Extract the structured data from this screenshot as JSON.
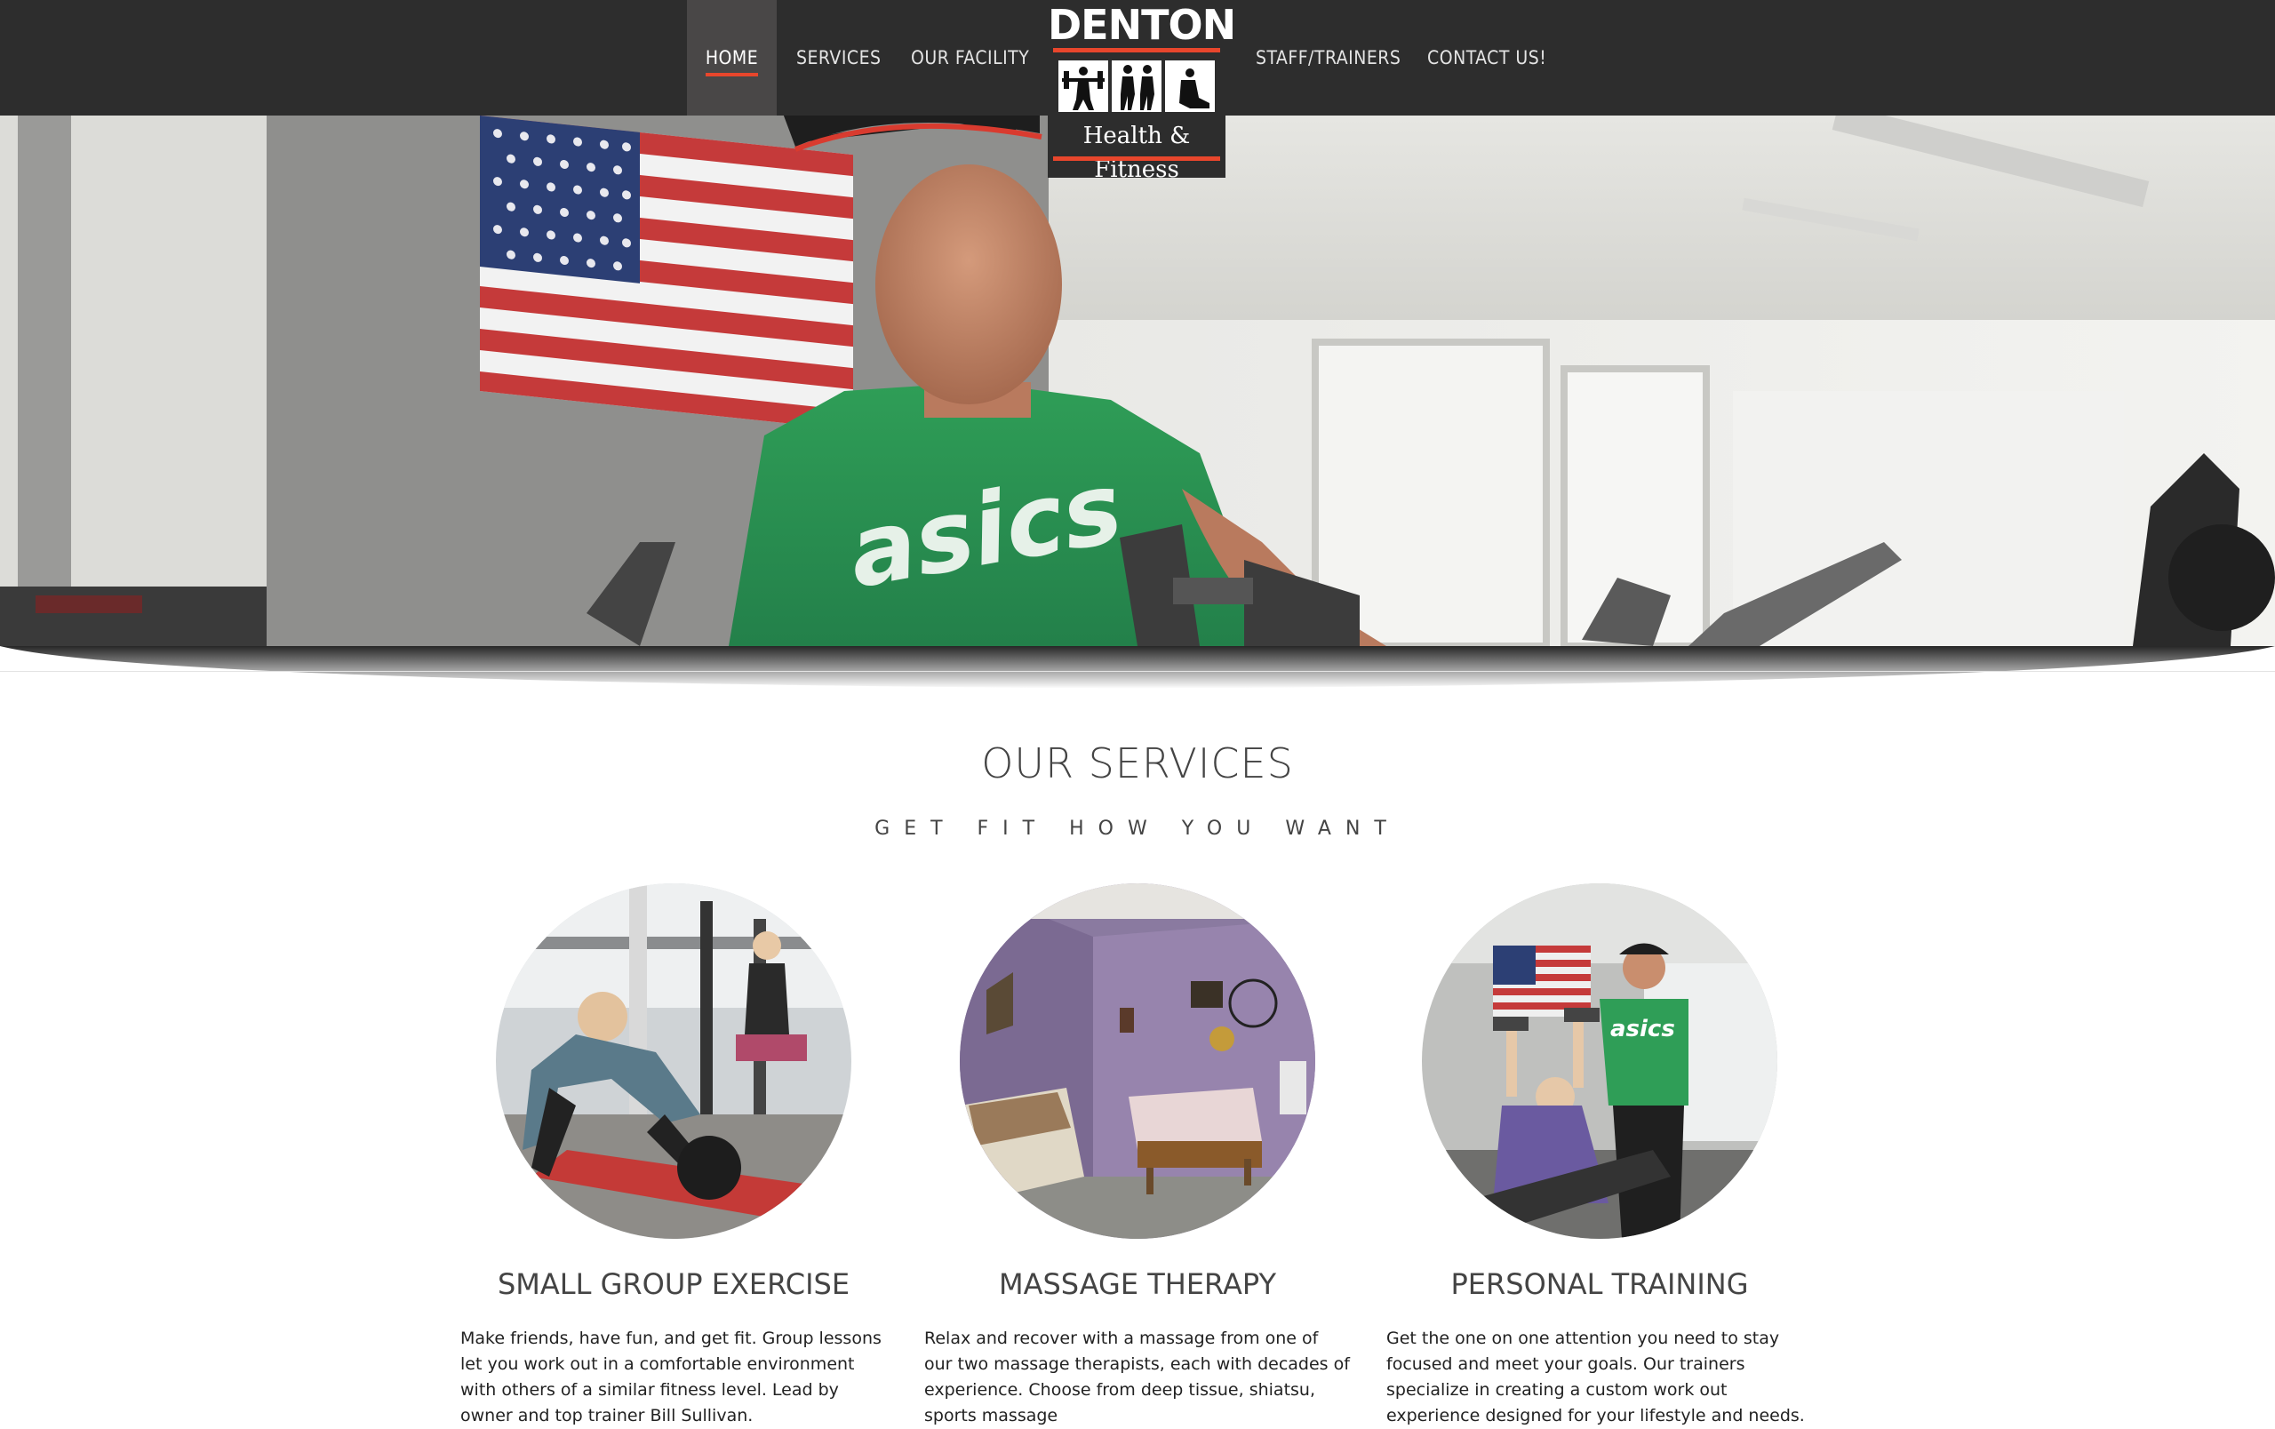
{
  "nav": {
    "items": [
      {
        "label": "HOME"
      },
      {
        "label": "SERVICES"
      },
      {
        "label": "OUR FACILITY"
      },
      {
        "label": "STAFF/TRAINERS"
      },
      {
        "label": "CONTACT US!"
      }
    ],
    "active": "HOME"
  },
  "logo": {
    "title": "DENTON",
    "subtitle": "Health & Fitness"
  },
  "hero": {
    "slides": 4,
    "active_slide": 3
  },
  "services_section": {
    "title": "OUR SERVICES",
    "subtitle": "GET FIT HOW YOU WANT",
    "items": [
      {
        "title": "SMALL GROUP EXERCISE",
        "description": "Make friends, have fun, and get fit. Group lessons let you work out in a comfortable environment with others of a similar fitness level. Lead by owner and top trainer Bill Sullivan."
      },
      {
        "title": "MASSAGE THERAPY",
        "description": "Relax and recover with a massage from one of our two massage therapists, each with decades of experience. Choose from deep tissue, shiatsu, sports massage"
      },
      {
        "title": "PERSONAL TRAINING",
        "description": "Get the one on one attention you need to stay focused and meet your goals. Our trainers specialize in creating a custom work out experience designed for your lifestyle and needs."
      }
    ]
  },
  "colors": {
    "nav_bg": "#2d2d2d",
    "accent": "#e8462c",
    "shirt_green": "#2f9e57"
  }
}
